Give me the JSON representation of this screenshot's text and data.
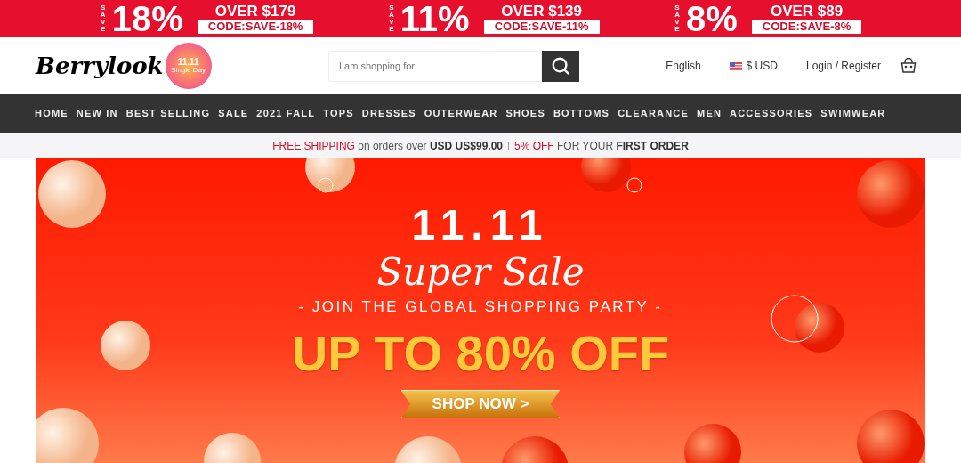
{
  "promo_bar": [
    {
      "save": "SAVE",
      "percent": "18%",
      "threshold": "OVER $179",
      "code": "CODE:SAVE-18%"
    },
    {
      "save": "SAVE",
      "percent": "11%",
      "threshold": "OVER $139",
      "code": "CODE:SAVE-11%"
    },
    {
      "save": "SAVE",
      "percent": "8%",
      "threshold": "OVER $89",
      "code": "CODE:SAVE-8%"
    }
  ],
  "header": {
    "logo": "Berrylook",
    "logo_badge": {
      "title": "11.11",
      "subtitle": "Single Day"
    },
    "search": {
      "placeholder": "I am shopping for"
    },
    "language": "English",
    "currency": "$ USD",
    "account": "Login / Register"
  },
  "nav": [
    "HOME",
    "NEW IN",
    "BEST SELLING",
    "SALE",
    "2021 FALL",
    "TOPS",
    "DRESSES",
    "OUTERWEAR",
    "SHOES",
    "BOTTOMS",
    "CLEARANCE",
    "MEN",
    "ACCESSORIES",
    "SWIMWEAR"
  ],
  "notice": [
    [
      {
        "text": "FREE SHIPPING",
        "kind": "accent"
      },
      {
        "text": "on orders over",
        "kind": "plain"
      },
      {
        "text": "USD US$99.00",
        "kind": "strong"
      }
    ],
    [
      {
        "text": "5% OFF",
        "kind": "accent"
      },
      {
        "text": "FOR YOUR",
        "kind": "plain"
      },
      {
        "text": "FIRST ORDER",
        "kind": "strong"
      }
    ]
  ],
  "hero": {
    "kind": "picture",
    "date": "11.11",
    "title": "Super Sale",
    "subtitle": "- JOIN THE GLOBAL SHOPPING PARTY -",
    "headline": "UP TO 80% OFF",
    "button": "SHOP NOW >"
  }
}
